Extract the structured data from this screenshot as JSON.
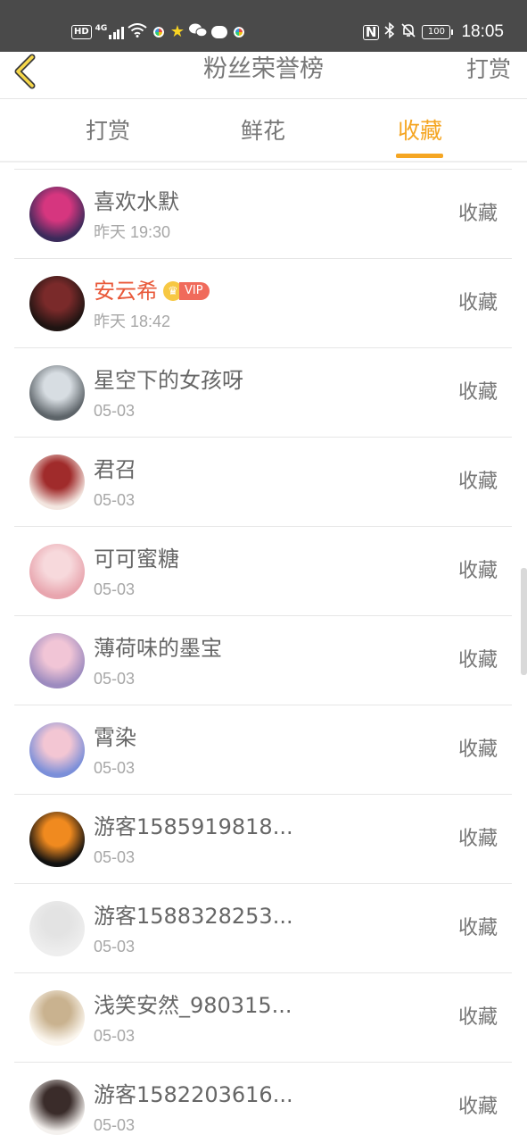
{
  "status_bar": {
    "hd": "HD",
    "network": "4G",
    "battery": "100",
    "time": "18:05"
  },
  "header": {
    "title": "粉丝荣誉榜",
    "right_action": "打赏"
  },
  "tabs": [
    {
      "label": "打赏",
      "active": false
    },
    {
      "label": "鲜花",
      "active": false
    },
    {
      "label": "收藏",
      "active": true
    }
  ],
  "accent_color": "#f5a623",
  "vip_name_color": "#e9593a",
  "list": [
    {
      "name": "喜欢水默",
      "time": "昨天 19:30",
      "action": "收藏",
      "vip": false,
      "avatar_colors": [
        "#3b2a5a",
        "#d6367f"
      ]
    },
    {
      "name": "安云希",
      "time": "昨天 18:42",
      "action": "收藏",
      "vip": true,
      "vip_label": "VIP",
      "avatar_colors": [
        "#1f1412",
        "#7a2a2a"
      ]
    },
    {
      "name": "星空下的女孩呀",
      "time": "05-03",
      "action": "收藏",
      "vip": false,
      "avatar_colors": [
        "#5d6469",
        "#d7dde2"
      ]
    },
    {
      "name": "君召",
      "time": "05-03",
      "action": "收藏",
      "vip": false,
      "avatar_colors": [
        "#f3e6e0",
        "#a02b2b"
      ]
    },
    {
      "name": "可可蜜糖",
      "time": "05-03",
      "action": "收藏",
      "vip": false,
      "avatar_colors": [
        "#e8a5ae",
        "#f7d9dc"
      ]
    },
    {
      "name": "薄荷味的墨宝",
      "time": "05-03",
      "action": "收藏",
      "vip": false,
      "avatar_colors": [
        "#9d8bbf",
        "#f1c5d6"
      ]
    },
    {
      "name": "霄染",
      "time": "05-03",
      "action": "收藏",
      "vip": false,
      "avatar_colors": [
        "#7b8fd9",
        "#f3c6d3"
      ]
    },
    {
      "name": "游客1585919818...",
      "time": "05-03",
      "action": "收藏",
      "vip": false,
      "avatar_colors": [
        "#111111",
        "#f08a1f"
      ]
    },
    {
      "name": "游客1588328253...",
      "time": "05-03",
      "action": "收藏",
      "vip": false,
      "avatar_colors": [
        "#eeeeee",
        "#e3e3e3"
      ]
    },
    {
      "name": "浅笑安然_980315...",
      "time": "05-03",
      "action": "收藏",
      "vip": false,
      "avatar_colors": [
        "#fbf6ee",
        "#c9b28f"
      ]
    },
    {
      "name": "游客1582203616...",
      "time": "05-03",
      "action": "收藏",
      "vip": false,
      "avatar_colors": [
        "#f4f1ee",
        "#3a2c2a"
      ]
    }
  ]
}
